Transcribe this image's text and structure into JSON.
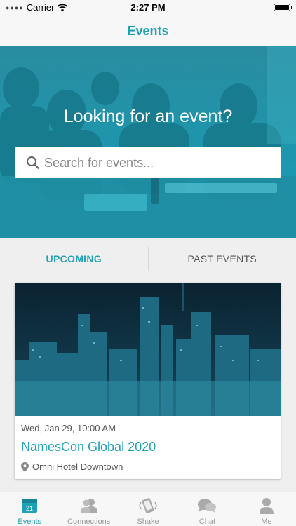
{
  "status_bar": {
    "carrier": "Carrier",
    "time": "2:27 PM",
    "battery_level": 1.0
  },
  "nav": {
    "title": "Events"
  },
  "hero": {
    "title": "Looking for an event?",
    "search": {
      "placeholder": "Search for events...",
      "value": ""
    }
  },
  "tabs": {
    "upcoming_label": "UPCOMING",
    "past_label": "PAST EVENTS",
    "selected": "UPCOMING"
  },
  "events": [
    {
      "date": "Wed, Jan 29, 10:00 AM",
      "title": "NamesCon Global 2020",
      "location": "Omni Hotel Downtown",
      "image": "city-skyline-night"
    }
  ],
  "tab_bar": {
    "items": [
      {
        "label": "Events",
        "icon": "calendar-icon",
        "badge_text": "21",
        "active": true
      },
      {
        "label": "Connections",
        "icon": "people-icon",
        "active": false
      },
      {
        "label": "Shake",
        "icon": "phone-shake-icon",
        "active": false
      },
      {
        "label": "Chat",
        "icon": "chat-icon",
        "active": false
      },
      {
        "label": "Me",
        "icon": "person-icon",
        "active": false
      }
    ]
  },
  "colors": {
    "accent": "#1ea0b5",
    "hero_overlay": "#1d96ad",
    "inactive": "#999999"
  }
}
